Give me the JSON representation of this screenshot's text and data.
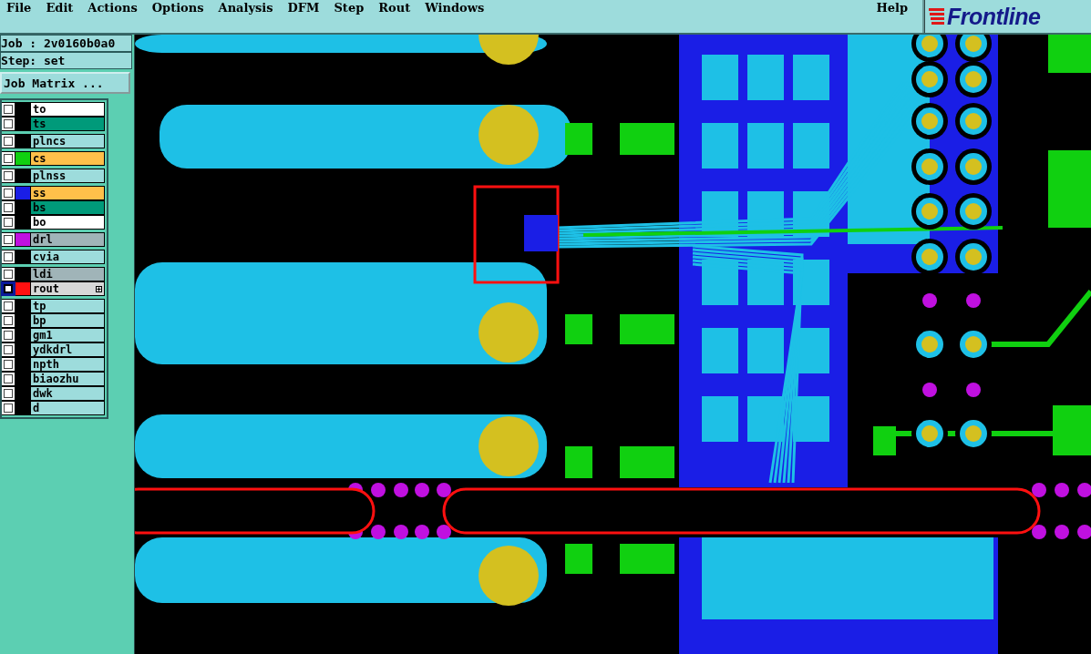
{
  "menu_bar": {
    "items": [
      "File",
      "Edit",
      "Actions",
      "Options",
      "Analysis",
      "DFM",
      "Step",
      "Rout",
      "Windows"
    ],
    "help": "Help"
  },
  "logo": {
    "text": "Frontline"
  },
  "sidebar": {
    "job": "Job : 2v0160b0a0",
    "step": "Step: set",
    "job_matrix_button": "Job Matrix ...",
    "layer_groups": [
      {
        "layers": [
          {
            "name": "to",
            "kind": "silk",
            "selected": false
          },
          {
            "name": "ts",
            "kind": "mask",
            "selected": false
          }
        ]
      },
      {
        "layers": [
          {
            "name": "plncs",
            "kind": "document",
            "selected": false
          }
        ]
      },
      {
        "layers": [
          {
            "name": "cs",
            "kind": "signal",
            "color": "#10d010",
            "selected": false
          }
        ]
      },
      {
        "layers": [
          {
            "name": "plnss",
            "kind": "document",
            "selected": false
          }
        ]
      },
      {
        "layers": [
          {
            "name": "ss",
            "kind": "signal",
            "color": "#1a1ee6",
            "selected": false
          },
          {
            "name": "bs",
            "kind": "mask",
            "selected": false
          },
          {
            "name": "bo",
            "kind": "silk",
            "selected": false
          }
        ]
      },
      {
        "layers": [
          {
            "name": "drl",
            "kind": "drill",
            "color": "#c010e0",
            "selected": false
          }
        ]
      },
      {
        "layers": [
          {
            "name": "cvia",
            "kind": "document",
            "selected": false
          }
        ]
      },
      {
        "layers": [
          {
            "name": "ldi",
            "kind": "drill",
            "selected": false
          },
          {
            "name": "rout",
            "kind": "rout",
            "color": "#ff1010",
            "selected": true
          }
        ]
      },
      {
        "layers": [
          {
            "name": "tp",
            "kind": "document",
            "selected": false
          },
          {
            "name": "bp",
            "kind": "document",
            "selected": false
          },
          {
            "name": "gm1",
            "kind": "document",
            "selected": false
          },
          {
            "name": "ydkdrl",
            "kind": "document",
            "selected": false
          },
          {
            "name": "npth",
            "kind": "document",
            "selected": false
          },
          {
            "name": "biaozhu",
            "kind": "document",
            "selected": false
          },
          {
            "name": "dwk",
            "kind": "document",
            "selected": false
          },
          {
            "name": "d",
            "kind": "document",
            "selected": false
          }
        ]
      }
    ]
  }
}
